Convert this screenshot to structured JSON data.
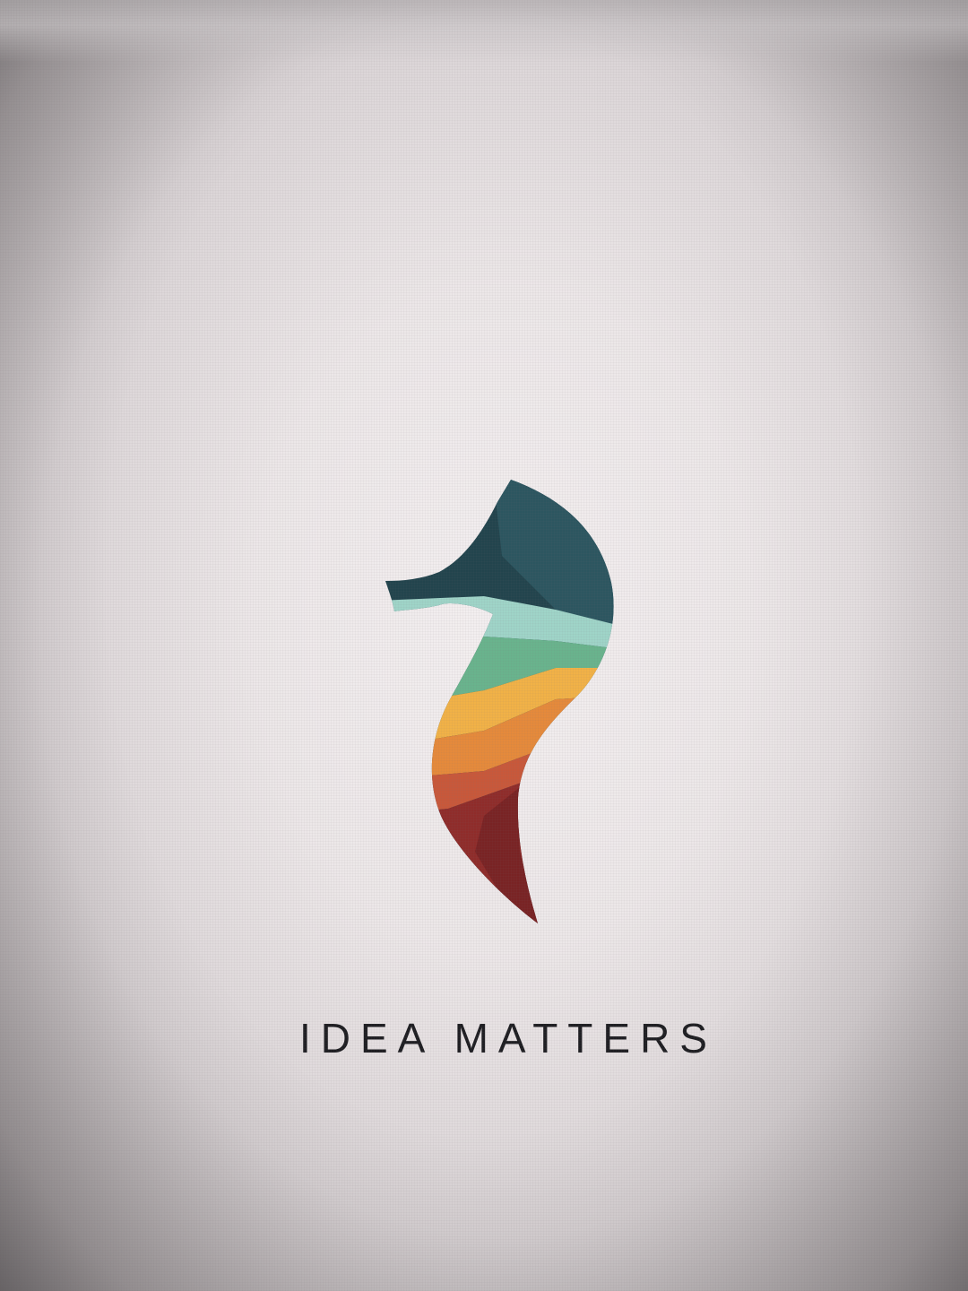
{
  "brand": {
    "tagline": "IDEA MATTERS",
    "logo_icon": "seahorse-logo-icon"
  },
  "colors": {
    "screen_background": "#ece7e8",
    "tagline_text": "#1e1e22",
    "logo_head_dark": "#22444d",
    "logo_head_mid": "#2c5660",
    "logo_band_teal": "#9fd4c8",
    "logo_band_green": "#69b48d",
    "logo_band_yellow": "#f1b247",
    "logo_band_orange": "#e58a3b",
    "logo_band_red_orange": "#c8583a",
    "logo_tail_red": "#8f2c2a",
    "logo_tail_dark": "#6f1f22"
  }
}
